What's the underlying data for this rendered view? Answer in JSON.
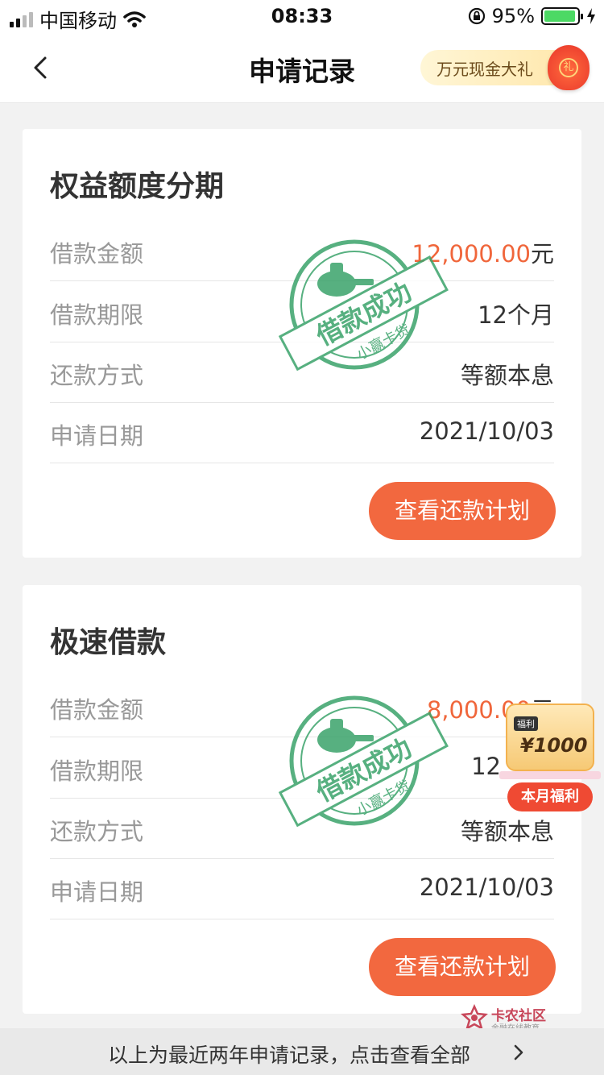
{
  "status_bar": {
    "carrier": "中国移动",
    "time": "08:33",
    "battery": "95%"
  },
  "nav": {
    "title": "申请记录",
    "promo": "万元现金大礼",
    "promo_badge": "礼"
  },
  "cards": [
    {
      "title": "权益额度分期",
      "rows": [
        {
          "label": "借款金额",
          "amount": "12,000.00",
          "unit": "元"
        },
        {
          "label": "借款期限",
          "value": "12个月"
        },
        {
          "label": "还款方式",
          "value": "等额本息"
        },
        {
          "label": "申请日期",
          "value": "2021/10/03"
        }
      ],
      "stamp_text": "借款成功",
      "stamp_sub": "小赢卡贷",
      "button": "查看还款计划"
    },
    {
      "title": "极速借款",
      "rows": [
        {
          "label": "借款金额",
          "amount": "8,000.00",
          "unit": "元"
        },
        {
          "label": "借款期限",
          "value": "12"
        },
        {
          "label": "还款方式",
          "value": "等额本息"
        },
        {
          "label": "申请日期",
          "value": "2021/10/03"
        }
      ],
      "stamp_text": "借款成功",
      "stamp_sub": "小赢卡贷",
      "button": "查看还款计划"
    }
  ],
  "float_badge": {
    "tag": "福利",
    "amount": "¥1000",
    "label": "本月福利"
  },
  "watermark": {
    "title": "卡农社区",
    "subtitle": "金融在线教育"
  },
  "footer": {
    "text": "以上为最近两年申请记录，点击查看全部"
  },
  "colors": {
    "accent": "#f2683f",
    "amount": "#f0663b",
    "stamp": "#3aa36a"
  }
}
